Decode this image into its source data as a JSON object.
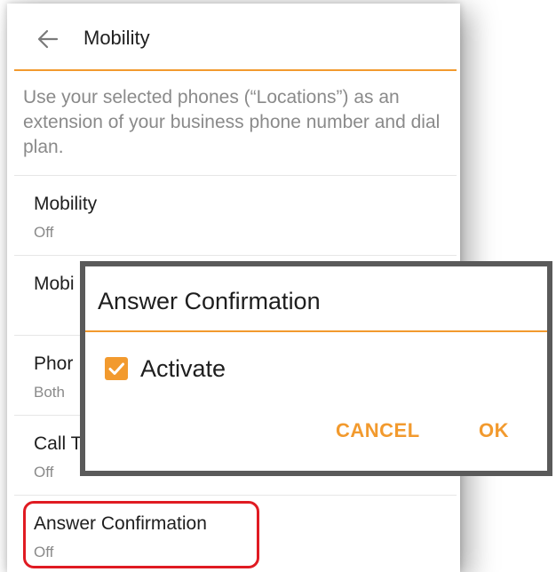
{
  "appbar": {
    "title": "Mobility",
    "back_icon": "arrow-left-icon"
  },
  "description": "Use your selected phones (“Locations”) as an extension of your business phone number and dial plan.",
  "settings": {
    "items": [
      {
        "title": "Mobility",
        "value": "Off"
      },
      {
        "title": "Mobi",
        "value": ""
      },
      {
        "title": "Phor",
        "value": "Both"
      },
      {
        "title": "Call T",
        "value": "Off"
      },
      {
        "title": "Answer Confirmation",
        "value": "Off"
      }
    ]
  },
  "dialog": {
    "title": "Answer Confirmation",
    "checkbox": {
      "label": "Activate",
      "checked": true
    },
    "cancel_label": "CANCEL",
    "ok_label": "OK"
  },
  "colors": {
    "accent": "#f29a2e",
    "highlight": "#e01b22",
    "dialog_border": "#5a5a5a"
  }
}
